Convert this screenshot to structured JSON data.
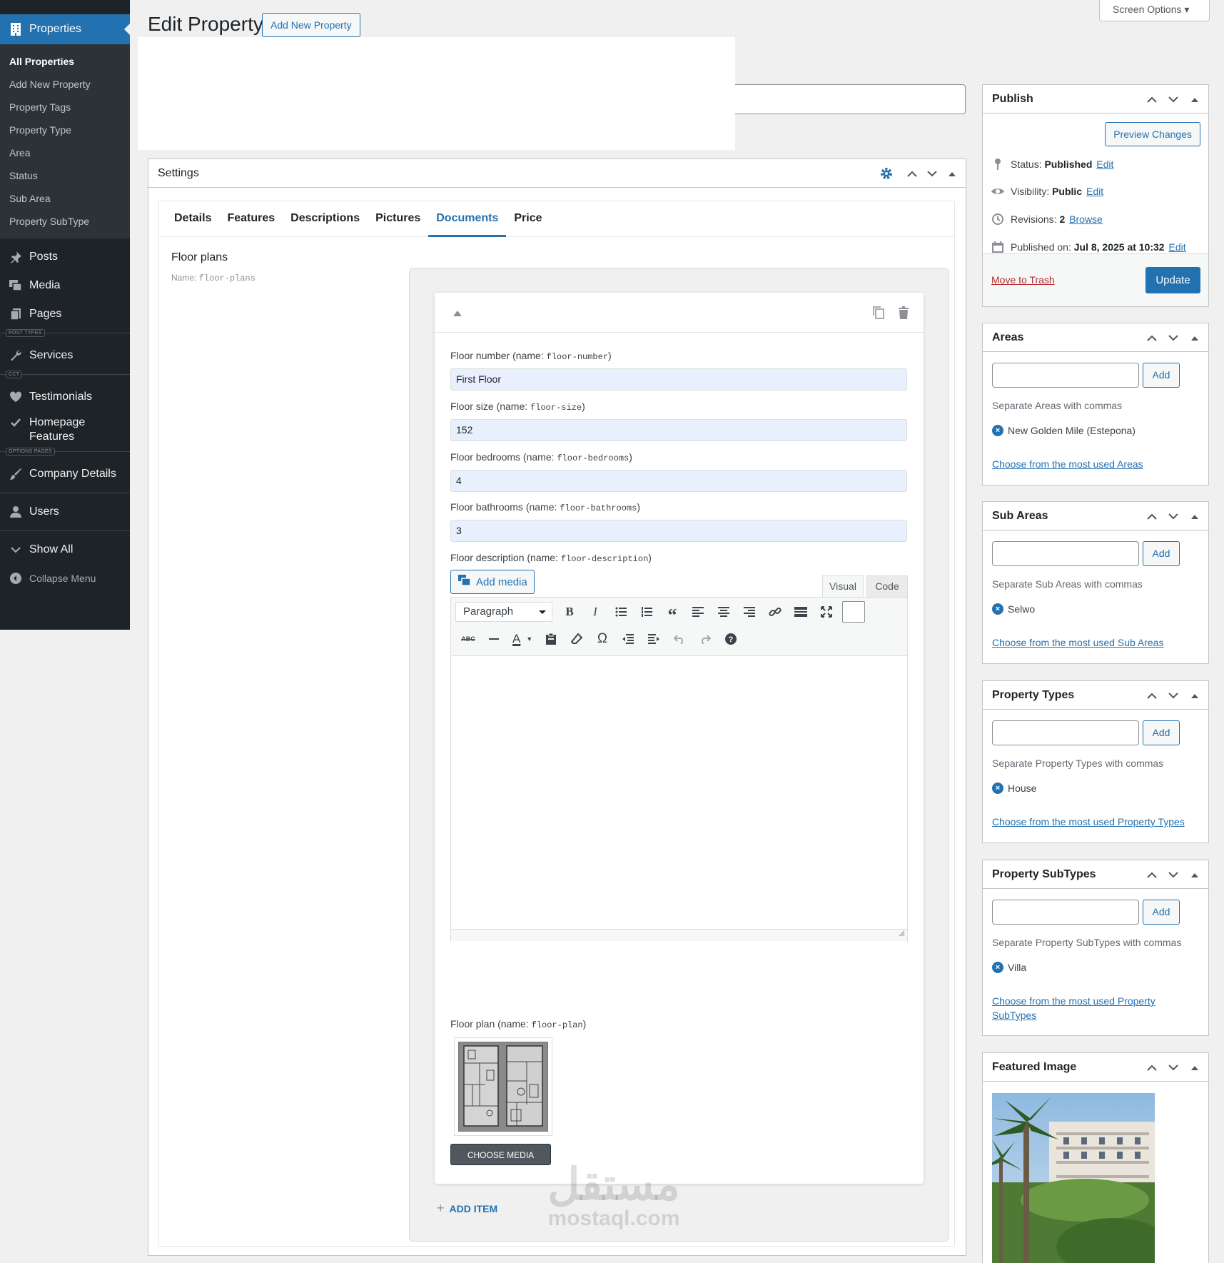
{
  "sidebar": {
    "properties_label": "Properties",
    "submenu": [
      "All Properties",
      "Add New Property",
      "Property Tags",
      "Property Type",
      "Area",
      "Status",
      "Sub Area",
      "Property SubType"
    ],
    "posts": "Posts",
    "media": "Media",
    "pages": "Pages",
    "sep_post_types": "POST TYPES",
    "services": "Services",
    "sep_cct": "CCT",
    "testimonials": "Testimonials",
    "homepage_features": "Homepage Features",
    "sep_options_pages": "OPTIONS PAGES",
    "company_details": "Company Details",
    "users": "Users",
    "show_all": "Show All",
    "collapse": "Collapse Menu"
  },
  "header": {
    "title": "Edit Property",
    "add_new": "Add New Property",
    "screen_options": "Screen Options ▾"
  },
  "settings": {
    "title": "Settings",
    "tabs": [
      "Details",
      "Features",
      "Descriptions",
      "Pictures",
      "Documents",
      "Price"
    ],
    "active_tab": "Documents",
    "field_label": "Floor plans",
    "field_name_prefix": "Name: ",
    "field_name_code": "floor-plans",
    "fields": [
      {
        "label": "Floor number (name: ",
        "code": "floor-number",
        "value": "First Floor"
      },
      {
        "label": "Floor size (name: ",
        "code": "floor-size",
        "value": "152"
      },
      {
        "label": "Floor bedrooms (name: ",
        "code": "floor-bedrooms",
        "value": "4"
      },
      {
        "label": "Floor bathrooms (name: ",
        "code": "floor-bathrooms",
        "value": "3"
      }
    ],
    "desc_label": "Floor description (name: ",
    "desc_code": "floor-description",
    "add_media": "Add media",
    "visual": "Visual",
    "code": "Code",
    "format": "Paragraph",
    "plan_label": "Floor plan (name: ",
    "plan_code": "floor-plan",
    "choose_media": "CHOOSE MEDIA",
    "add_item": "ADD ITEM",
    "close_paren": ")"
  },
  "publish": {
    "title": "Publish",
    "preview": "Preview Changes",
    "status_label": "Status: ",
    "status_value": "Published",
    "visibility_label": "Visibility: ",
    "visibility_value": "Public",
    "revisions_label": "Revisions: ",
    "revisions_value": "2",
    "browse": "Browse",
    "published_label": "Published on: ",
    "published_value": "Jul 8, 2025 at 10:32",
    "edit": "Edit",
    "trash": "Move to Trash",
    "update": "Update"
  },
  "taxonomies": [
    {
      "title": "Areas",
      "add": "Add",
      "help": "Separate Areas with commas",
      "tag": "New Golden Mile (Estepona)",
      "link": "Choose from the most used Areas"
    },
    {
      "title": "Sub Areas",
      "add": "Add",
      "help": "Separate Sub Areas with commas",
      "tag": "Selwo",
      "link": "Choose from the most used Sub Areas"
    },
    {
      "title": "Property Types",
      "add": "Add",
      "help": "Separate Property Types with commas",
      "tag": "House",
      "link": "Choose from the most used Property Types"
    },
    {
      "title": "Property SubTypes",
      "add": "Add",
      "help": "Separate Property SubTypes with commas",
      "tag": "Villa",
      "link": "Choose from the most used Property SubTypes"
    }
  ],
  "featured": {
    "title": "Featured Image"
  },
  "watermark": {
    "ar": "مستقل",
    "en": "mostaql.com"
  },
  "colors": {
    "accent": "#2271b1",
    "sidebar": "#1d2327",
    "danger": "#b32d2e"
  }
}
